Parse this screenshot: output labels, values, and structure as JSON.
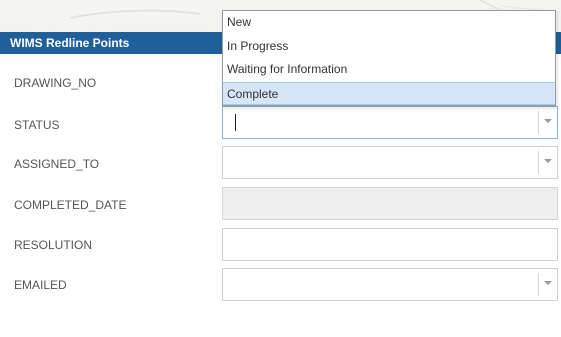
{
  "window": {
    "title": "WIMS Redline Points",
    "close_glyph": "×"
  },
  "fields": [
    {
      "label": "DRAWING_NO",
      "value": ""
    },
    {
      "label": "STATUS",
      "value": ""
    },
    {
      "label": "ASSIGNED_TO",
      "value": ""
    },
    {
      "label": "COMPLETED_DATE",
      "value": ""
    },
    {
      "label": "RESOLUTION",
      "value": ""
    },
    {
      "label": "EMAILED",
      "value": ""
    }
  ],
  "status_dropdown": {
    "options": [
      "New",
      "In Progress",
      "Waiting for Information",
      "Complete"
    ],
    "highlighted": "Complete"
  },
  "icons": {
    "dropdown_arrow": "chevron-down-icon",
    "close": "close-icon"
  },
  "colors": {
    "titlebar": "#1f5f9a",
    "highlight": "#d4e6f7",
    "disabled_field": "#efefef"
  }
}
